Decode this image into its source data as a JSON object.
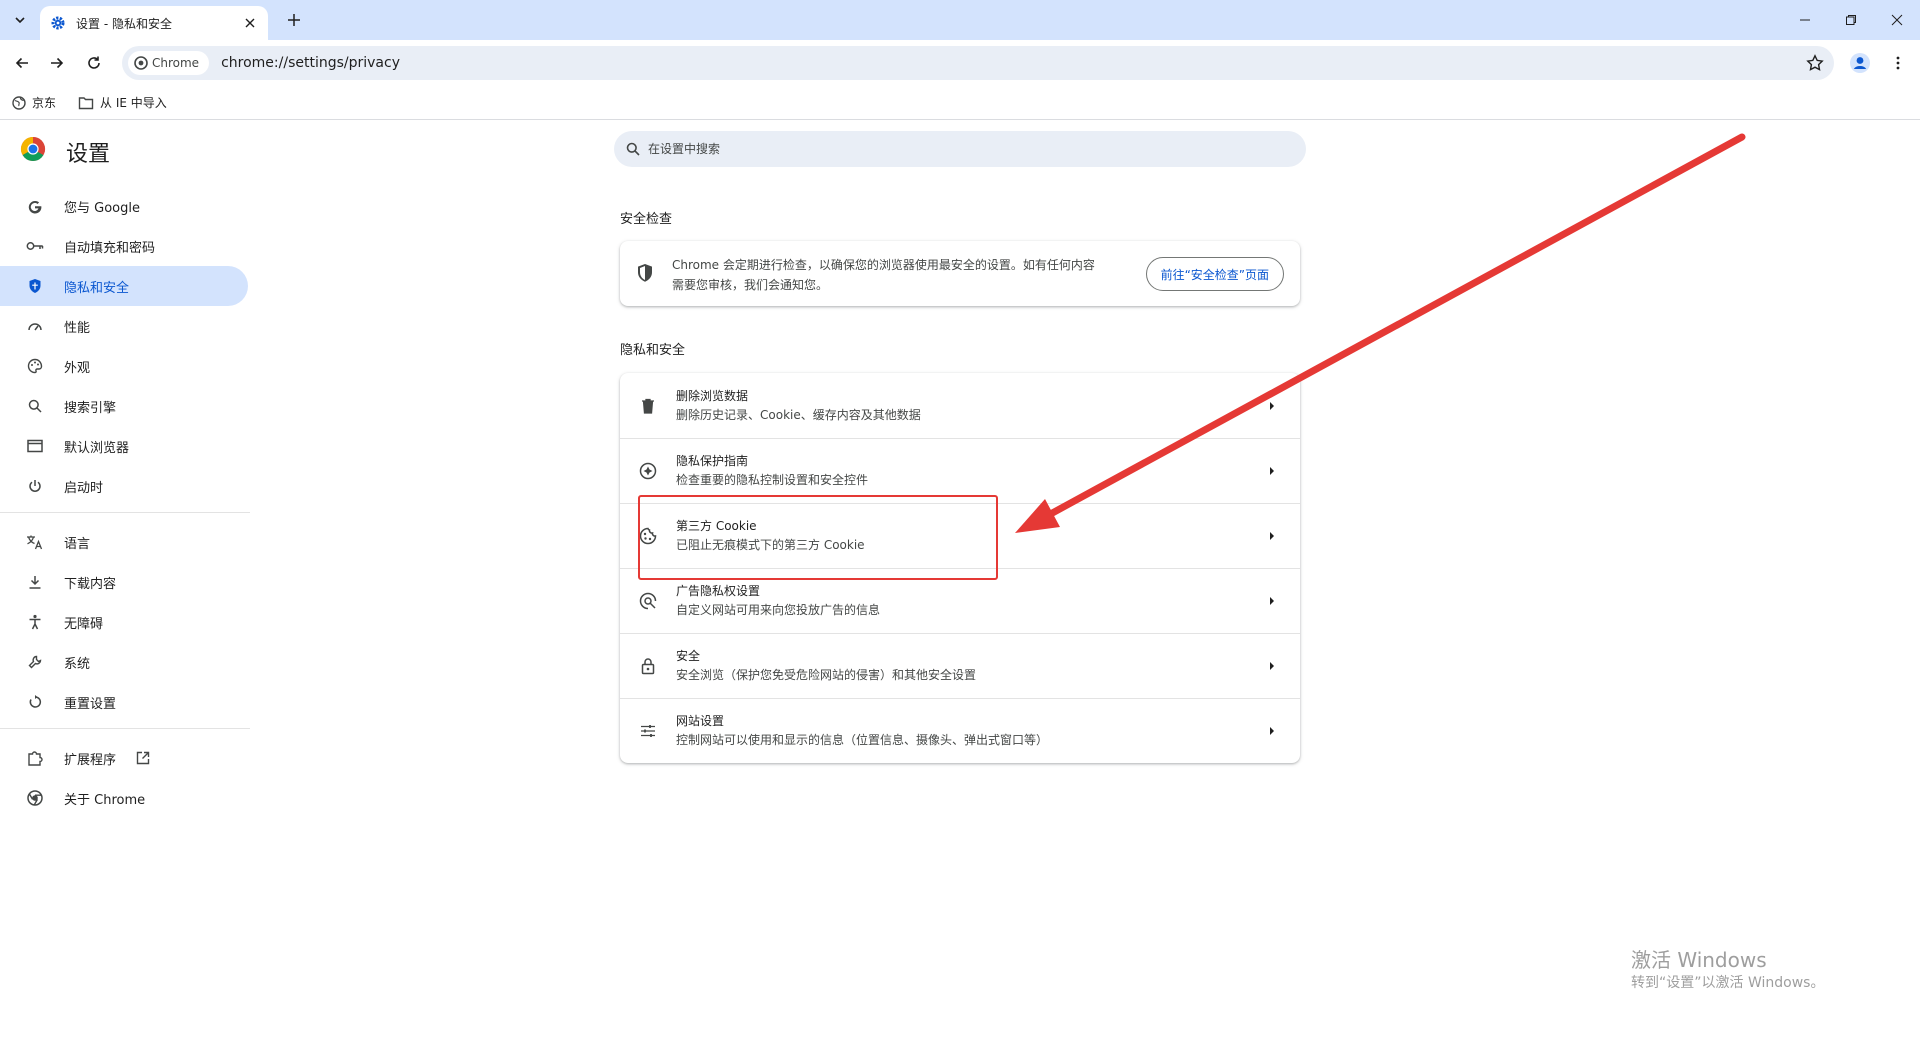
{
  "tab": {
    "title": "设置 - 隐私和安全"
  },
  "omnibox": {
    "chip_label": "Chrome",
    "url": "chrome://settings/privacy"
  },
  "bookmarks": [
    {
      "label": "京东"
    },
    {
      "label": "从 IE 中导入"
    }
  ],
  "settings": {
    "title": "设置",
    "search_placeholder": "在设置中搜索"
  },
  "sidebar": {
    "items": [
      {
        "label": "您与 Google",
        "icon": "google-g-icon"
      },
      {
        "label": "自动填充和密码",
        "icon": "key-icon"
      },
      {
        "label": "隐私和安全",
        "icon": "shield-icon",
        "active": true
      },
      {
        "label": "性能",
        "icon": "speedometer-icon"
      },
      {
        "label": "外观",
        "icon": "palette-icon"
      },
      {
        "label": "搜索引擎",
        "icon": "search-icon"
      },
      {
        "label": "默认浏览器",
        "icon": "browser-window-icon"
      },
      {
        "label": "启动时",
        "icon": "power-icon"
      },
      {
        "label": "语言",
        "icon": "translate-icon"
      },
      {
        "label": "下载内容",
        "icon": "download-icon"
      },
      {
        "label": "无障碍",
        "icon": "accessibility-icon"
      },
      {
        "label": "系统",
        "icon": "wrench-icon"
      },
      {
        "label": "重置设置",
        "icon": "reset-icon"
      },
      {
        "label": "扩展程序",
        "icon": "puzzle-icon"
      },
      {
        "label": "关于 Chrome",
        "icon": "chrome-icon"
      }
    ]
  },
  "safety_check": {
    "heading": "安全检查",
    "text": "Chrome 会定期进行检查，以确保您的浏览器使用最安全的设置。如有任何内容需要您审核，我们会通知您。",
    "button": "前往“安全检查”页面"
  },
  "privacy": {
    "heading": "隐私和安全",
    "rows": [
      {
        "title": "删除浏览数据",
        "subtitle": "删除历史记录、Cookie、缓存内容及其他数据",
        "icon": "trash-icon"
      },
      {
        "title": "隐私保护指南",
        "subtitle": "检查重要的隐私控制设置和安全控件",
        "icon": "compass-icon"
      },
      {
        "title": "第三方 Cookie",
        "subtitle": "已阻止无痕模式下的第三方 Cookie",
        "icon": "cookie-icon"
      },
      {
        "title": "广告隐私权设置",
        "subtitle": "自定义网站可用来向您投放广告的信息",
        "icon": "ad-privacy-icon"
      },
      {
        "title": "安全",
        "subtitle": "安全浏览（保护您免受危险网站的侵害）和其他安全设置",
        "icon": "lock-icon"
      },
      {
        "title": "网站设置",
        "subtitle": "控制网站可以使用和显示的信息（位置信息、摄像头、弹出式窗口等）",
        "icon": "sliders-icon"
      }
    ]
  },
  "watermark": {
    "line1": "激活 Windows",
    "line2": "转到“设置”以激活 Windows。"
  },
  "colors": {
    "accent": "#0b57d0",
    "active_bg": "#d3e3fd",
    "annotation": "#e53935",
    "tabstrip": "#d3e3fd"
  }
}
